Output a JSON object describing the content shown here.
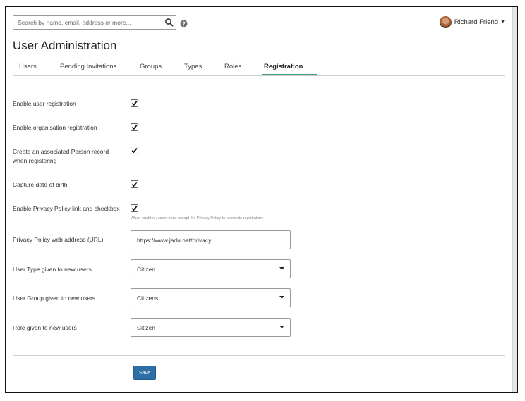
{
  "search": {
    "placeholder": "Search by name, email, address or more..."
  },
  "user": {
    "name": "Richard Friend"
  },
  "page": {
    "title": "User Administration"
  },
  "tabs": [
    {
      "label": "Users"
    },
    {
      "label": "Pending Invitations"
    },
    {
      "label": "Groups"
    },
    {
      "label": "Types"
    },
    {
      "label": "Roles"
    },
    {
      "label": "Registration",
      "active": true
    }
  ],
  "form": {
    "enable_user_registration": {
      "label": "Enable user registration",
      "checked": true
    },
    "enable_org_registration": {
      "label": "Enable organisation registration",
      "checked": true
    },
    "create_person_record": {
      "label_line1": "Create an associated Person record",
      "label_line2": "when registering",
      "checked": true
    },
    "capture_dob": {
      "label": "Capture date of birth",
      "checked": true
    },
    "privacy_checkbox": {
      "label": "Enable Privacy Policy link and checkbox",
      "checked": true,
      "help": "When enabled, users must accept the Privacy Policy to complete registration."
    },
    "privacy_url": {
      "label": "Privacy Policy web address (URL)",
      "value": "https://www.jadu.net/privacy"
    },
    "user_type": {
      "label": "User Type given to new users",
      "value": "Citizen"
    },
    "user_group": {
      "label": "User Group given to new users",
      "value": "Citizens"
    },
    "role": {
      "label": "Role given to new users",
      "value": "Citizen"
    },
    "save_label": "Save"
  },
  "colors": {
    "tab_accent": "#3d9f6f",
    "primary_button": "#2e6ea6"
  },
  "icons": {
    "search": "magnifier-icon",
    "help": "question-circle-icon",
    "caret": "caret-down-icon",
    "check": "checkmark-icon"
  }
}
